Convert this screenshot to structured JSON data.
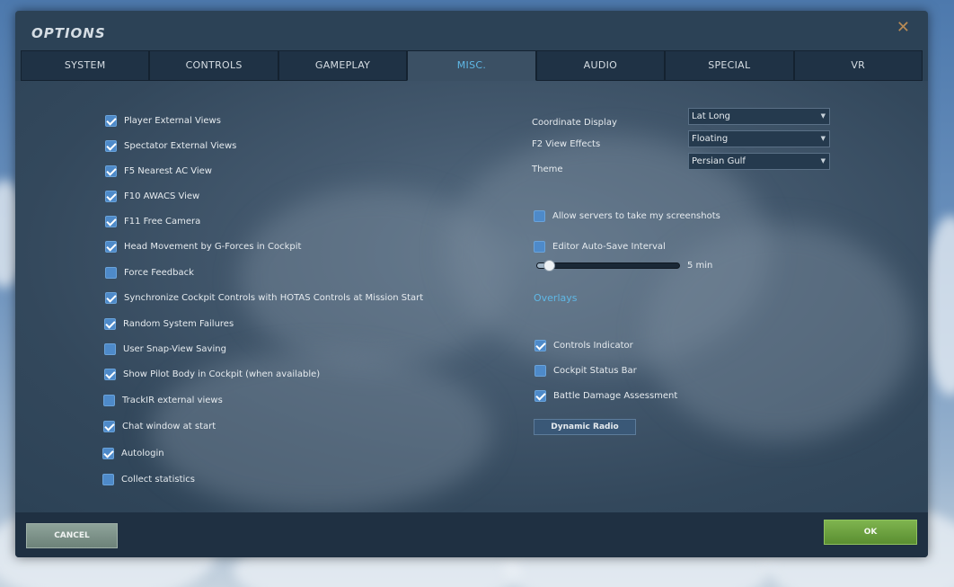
{
  "window": {
    "title": "OPTIONS",
    "close_symbol": "✕"
  },
  "tabs": [
    {
      "label": "SYSTEM",
      "active": false
    },
    {
      "label": "CONTROLS",
      "active": false
    },
    {
      "label": "GAMEPLAY",
      "active": false
    },
    {
      "label": "MISC.",
      "active": true
    },
    {
      "label": "AUDIO",
      "active": false
    },
    {
      "label": "SPECIAL",
      "active": false
    },
    {
      "label": "VR",
      "active": false
    }
  ],
  "left_options": [
    {
      "label": "Player External Views",
      "checked": true
    },
    {
      "label": "Spectator External Views",
      "checked": true
    },
    {
      "label": "F5 Nearest AC View",
      "checked": true
    },
    {
      "label": "F10 AWACS View",
      "checked": true
    },
    {
      "label": "F11 Free Camera",
      "checked": true
    },
    {
      "label": "Head Movement by G-Forces in Cockpit",
      "checked": true
    },
    {
      "label": "Force Feedback",
      "checked": false
    },
    {
      "label": "Synchronize Cockpit Controls with HOTAS Controls at Mission Start",
      "checked": true
    },
    {
      "label": "Random System Failures",
      "checked": true
    },
    {
      "label": "User Snap-View Saving",
      "checked": false
    },
    {
      "label": "Show Pilot Body in Cockpit (when available)",
      "checked": true
    },
    {
      "label": "TrackIR external views",
      "checked": false
    },
    {
      "label": "Chat window at start",
      "checked": true
    },
    {
      "label": "Autologin",
      "checked": true
    },
    {
      "label": "Collect statistics",
      "checked": false
    }
  ],
  "settings": {
    "coordinate_display": {
      "label": "Coordinate Display",
      "value": "Lat Long"
    },
    "f2_view_effects": {
      "label": "F2 View Effects",
      "value": "Floating"
    },
    "theme": {
      "label": "Theme",
      "value": "Persian Gulf"
    },
    "dropdown_arrow": "▼"
  },
  "right_options": {
    "allow_screenshots": {
      "label": "Allow servers to take my screenshots",
      "checked": false
    },
    "editor_autosave": {
      "label": "Editor Auto-Save Interval",
      "checked": false
    },
    "autosave_slider": {
      "value_label": "5 min",
      "fraction": 0.05
    }
  },
  "overlays": {
    "link_label": "Overlays",
    "items": [
      {
        "label": "Controls Indicator",
        "checked": true
      },
      {
        "label": "Cockpit Status Bar",
        "checked": false
      },
      {
        "label": "Battle Damage Assessment",
        "checked": true
      }
    ]
  },
  "buttons": {
    "dynamic_radio": "Dynamic Radio",
    "cancel": "CANCEL",
    "ok": "OK"
  }
}
